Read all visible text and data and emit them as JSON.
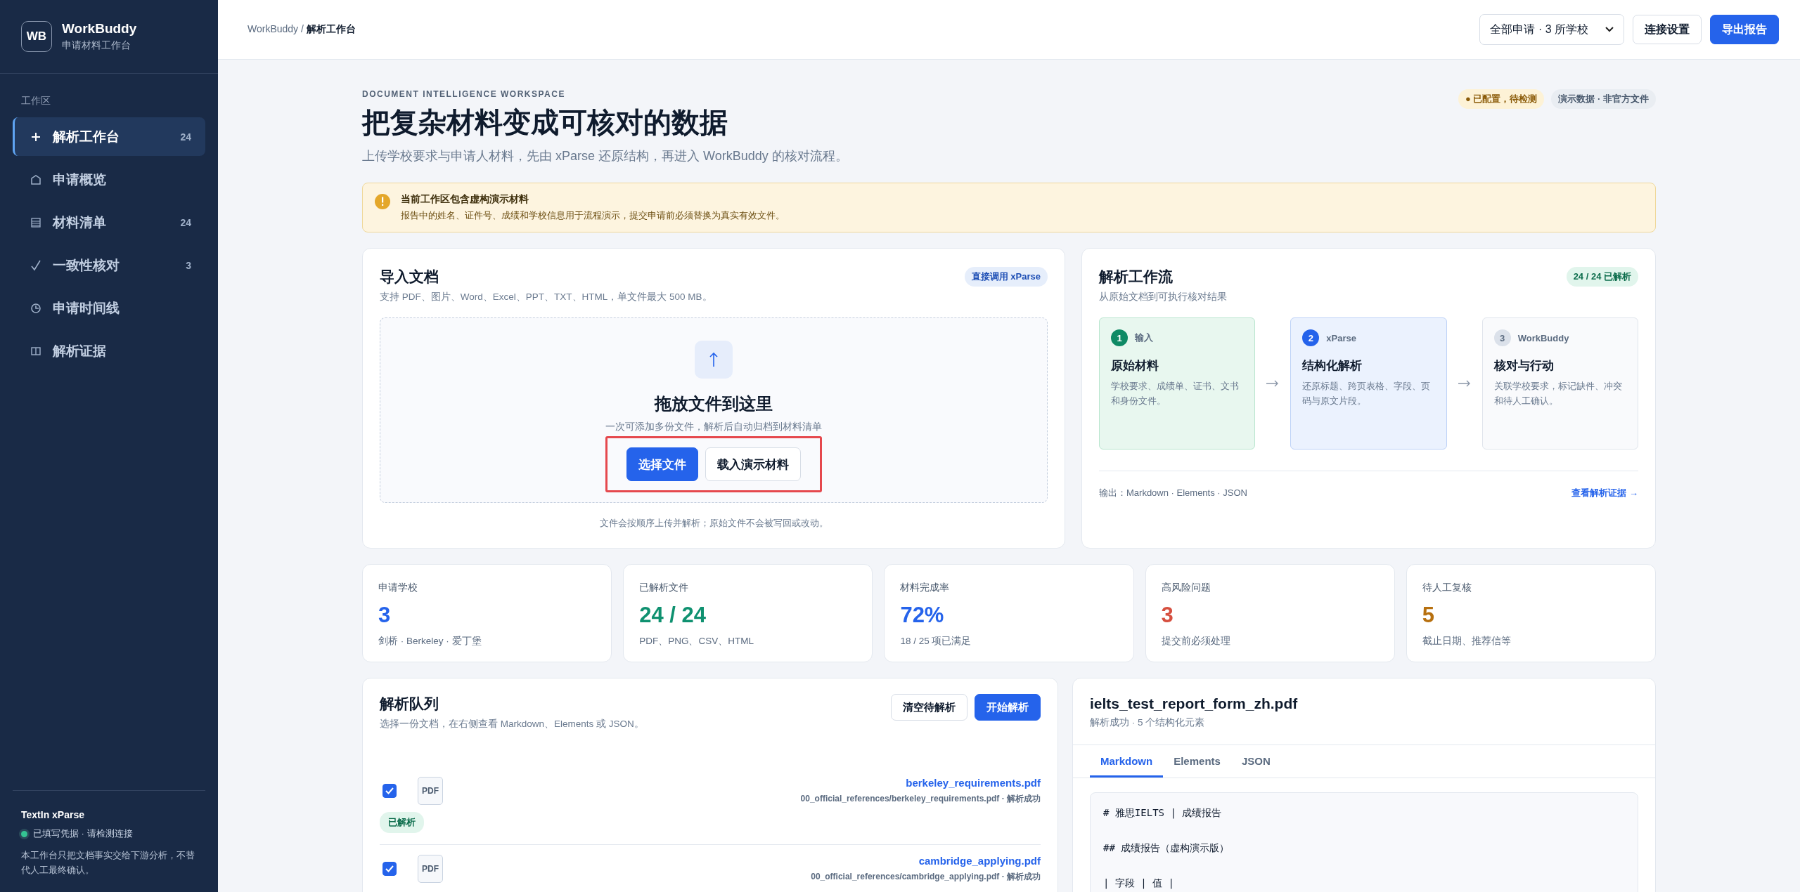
{
  "sidebar": {
    "logo": "WB",
    "app_name": "WorkBuddy",
    "app_subtitle": "申请材料工作台",
    "section_label": "工作区",
    "items": [
      {
        "kind": "plus",
        "label": "解析工作台",
        "count": "24",
        "selected": true
      },
      {
        "kind": "house",
        "label": "申请概览",
        "selected": false
      },
      {
        "kind": "list",
        "label": "材料清单",
        "count": "24",
        "selected": false
      },
      {
        "kind": "check",
        "label": "一致性核对",
        "count": "3",
        "selected": false
      },
      {
        "kind": "clock",
        "label": "申请时间线",
        "selected": false
      },
      {
        "kind": "columns",
        "label": "解析证据",
        "selected": false
      }
    ],
    "footer": {
      "title": "TextIn xParse",
      "status": "已填写凭据 · 请检测连接",
      "note": "本工作台只把文档事实交给下游分析，不替代人工最终确认。"
    }
  },
  "topbar": {
    "breadcrumb_root": "WorkBuddy",
    "breadcrumb_separator": "/",
    "breadcrumb_current": "解析工作台",
    "scope_select": "全部申请 · 3 所学校",
    "buttons": [
      {
        "label": "连接设置",
        "kind": "secondary"
      },
      {
        "label": "导出报告",
        "kind": "primary"
      }
    ]
  },
  "hero": {
    "eyebrow": "DOCUMENT INTELLIGENCE WORKSPACE",
    "title": "把复杂材料变成可核对的数据",
    "subtitle": "上传学校要求与申请人材料，先由 xParse 还原结构，再进入 WorkBuddy 的核对流程。",
    "badges": [
      {
        "label": "● 已配置，待检测",
        "kind": "warning"
      },
      {
        "label": "演示数据 · 非官方文件",
        "kind": "neutral"
      }
    ]
  },
  "alert": {
    "title": "当前工作区包含虚构演示材料",
    "text": "报告中的姓名、证件号、成绩和学校信息用于流程演示，提交申请前必须替换为真实有效文件。"
  },
  "import": {
    "title": "导入文档",
    "badge": "直接调用 xParse",
    "subtitle": "支持 PDF、图片、Word、Excel、PPT、TXT、HTML，单文件最大 500 MB。",
    "drop_title": "拖放文件到这里",
    "drop_hint": "一次可添加多份文件，解析后自动归档到材料清单",
    "buttons": [
      {
        "label": "选择文件",
        "kind": "primary"
      },
      {
        "label": "载入演示材料",
        "kind": "secondary"
      }
    ],
    "highlighted": true,
    "footnote": "文件会按顺序上传并解析；原始文件不会被写回或改动。"
  },
  "workflow": {
    "title": "解析工作流",
    "badge": "24 / 24 已解析",
    "subtitle": "从原始文档到可执行核对结果",
    "steps": [
      {
        "number": "1",
        "tag": "输入",
        "title": "原始材料",
        "description": "学校要求、成绩单、证书、文书和身份文件。",
        "kind": "input"
      },
      {
        "number": "2",
        "tag": "xParse",
        "title": "结构化解析",
        "description": "还原标题、跨页表格、字段、页码与原文片段。",
        "kind": "parse"
      },
      {
        "number": "3",
        "tag": "WorkBuddy",
        "title": "核对与行动",
        "description": "关联学校要求，标记缺件、冲突和待人工确认。",
        "kind": "action"
      }
    ],
    "output": "输出：Markdown · Elements · JSON",
    "link": "查看解析证据 →"
  },
  "stats": [
    {
      "label": "申请学校",
      "value": "3",
      "note": "剑桥 · Berkeley · 爱丁堡",
      "color": "#2563eb"
    },
    {
      "label": "已解析文件",
      "value": "24 / 24",
      "note": "PDF、PNG、CSV、HTML",
      "color": "#0f9170"
    },
    {
      "label": "材料完成率",
      "value": "72%",
      "note": "18 / 25 项已满足",
      "color": "#2563eb"
    },
    {
      "label": "高风险问题",
      "value": "3",
      "note": "提交前必须处理",
      "color": "#d64f3f"
    },
    {
      "label": "待人工复核",
      "value": "5",
      "note": "截止日期、推荐信等",
      "color": "#b7700f"
    }
  ],
  "queue": {
    "title": "解析队列",
    "subtitle": "选择一份文档，在右侧查看 Markdown、Elements 或 JSON。",
    "buttons": [
      {
        "label": "清空待解析",
        "kind": "secondary"
      },
      {
        "label": "开始解析",
        "kind": "primary"
      }
    ],
    "rows": [
      {
        "checked": true,
        "file_type": "PDF",
        "name": "berkeley_requirements.pdf",
        "path": "00_official_references/berkeley_requirements.pdf · 解析成功",
        "status": "已解析"
      },
      {
        "checked": true,
        "file_type": "PDF",
        "name": "cambridge_applying.pdf",
        "path": "00_official_references/cambridge_applying.pdf · 解析成功"
      }
    ]
  },
  "preview": {
    "title": "ielts_test_report_form_zh.pdf",
    "subtitle": "解析成功 · 5 个结构化元素",
    "tabs": [
      {
        "label": "Markdown",
        "selected": true
      },
      {
        "label": "Elements",
        "selected": false
      },
      {
        "label": "JSON",
        "selected": false
      }
    ],
    "lines": [
      "# 雅思IELTS | 成绩报告",
      "## 成绩报告（虚构演示版）",
      "| 字段 | 值 |"
    ]
  }
}
